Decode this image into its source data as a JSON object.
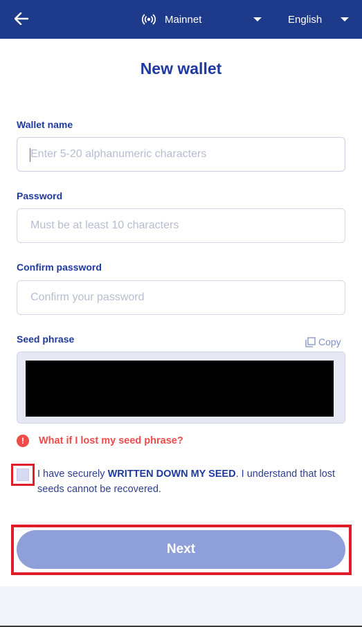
{
  "header": {
    "network_label": "Mainnet",
    "language_label": "English",
    "icons": {
      "back": "arrow-left-icon",
      "network": "broadcast-icon",
      "network_dropdown": "caret-down-icon",
      "language_dropdown": "caret-down-icon"
    }
  },
  "page": {
    "title": "New wallet"
  },
  "form": {
    "wallet_name": {
      "label": "Wallet name",
      "placeholder": "Enter 5-20 alphanumeric characters",
      "value": ""
    },
    "password": {
      "label": "Password",
      "placeholder": "Must be at least 10 characters",
      "value": ""
    },
    "confirm_password": {
      "label": "Confirm password",
      "placeholder": "Confirm your password",
      "value": ""
    },
    "seed": {
      "label": "Seed phrase",
      "copy_label": "Copy"
    },
    "lost_seed_link": "What if I lost my seed phrase?",
    "acknowledge": {
      "text_before": "I have securely ",
      "text_bold": "WRITTEN DOWN MY SEED",
      "text_after": ". I understand that lost seeds cannot be recovered.",
      "checked": false
    },
    "next_label": "Next"
  },
  "colors": {
    "header_bg": "#1e3a8a",
    "title": "#1e3a9e",
    "warning": "#ee4b4b",
    "button_disabled": "#8e9fd9",
    "highlight": "#e21d2a"
  }
}
